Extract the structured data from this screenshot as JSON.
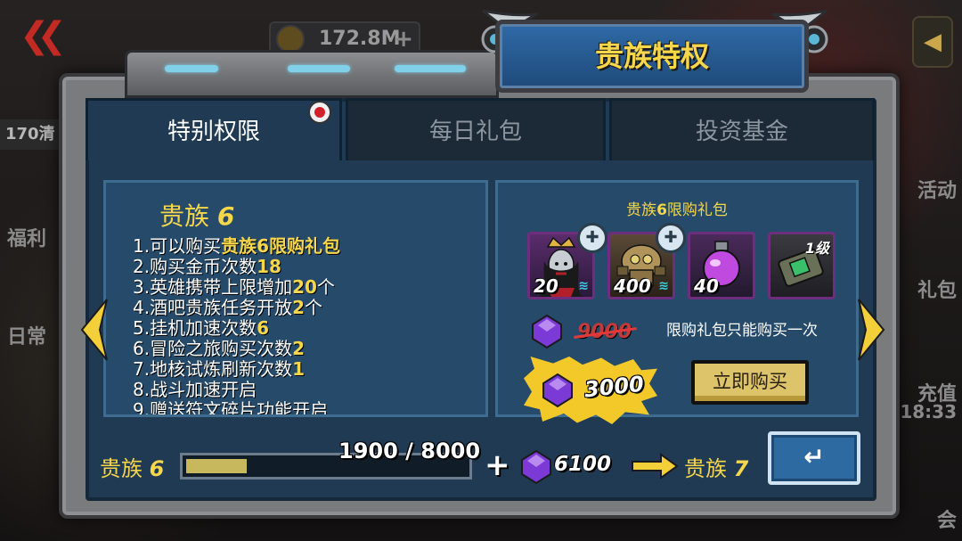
{
  "background": {
    "gold_amount": "172.8M",
    "count_badge": "170",
    "count_badge_suffix": "清",
    "left_labels": [
      "福利",
      "日常"
    ],
    "right_labels": [
      "活动",
      "礼包",
      "充值",
      "18:33",
      "会"
    ]
  },
  "title": "贵族特权",
  "tabs": [
    {
      "label": "特别权限",
      "active": true,
      "has_dot": true
    },
    {
      "label": "每日礼包",
      "active": false
    },
    {
      "label": "投资基金",
      "active": false
    }
  ],
  "privileges": {
    "heading_prefix": "贵族",
    "heading_level": "6",
    "items": [
      {
        "num": "1.",
        "text": "可以购买",
        "highlight": "贵族6限购礼包",
        "suffix": ""
      },
      {
        "num": "2.",
        "text": "购买金币次数",
        "highlight": "18",
        "suffix": ""
      },
      {
        "num": "3.",
        "text": "英雄携带上限增加",
        "highlight": "20",
        "suffix": "个"
      },
      {
        "num": "4.",
        "text": "酒吧贵族任务开放",
        "highlight": "2",
        "suffix": "个"
      },
      {
        "num": "5.",
        "text": "挂机加速次数",
        "highlight": "6",
        "suffix": ""
      },
      {
        "num": "6.",
        "text": "冒险之旅购买次数",
        "highlight": "2",
        "suffix": ""
      },
      {
        "num": "7.",
        "text": "地核试炼刷新次数",
        "highlight": "1",
        "suffix": ""
      },
      {
        "num": "8.",
        "text": "战斗加速开启",
        "highlight": "",
        "suffix": ""
      },
      {
        "num": "9.",
        "text": "赠送符文碎片功能开启",
        "highlight": "",
        "suffix": ""
      }
    ]
  },
  "gift": {
    "title_prefix": "贵族",
    "title_level": "6",
    "title_suffix": "限购礼包",
    "items": [
      {
        "icon": "queen-hero-icon",
        "qty": "20"
      },
      {
        "icon": "mech-hero-icon",
        "qty": "400"
      },
      {
        "icon": "potion-icon",
        "qty": "40"
      },
      {
        "icon": "rune-chip-icon",
        "level": "1级"
      }
    ],
    "original_price": "9000",
    "limit_note": "限购礼包只能购买一次",
    "sale_price": "3000",
    "buy_label": "立即购买"
  },
  "progress": {
    "current_rank_prefix": "贵族",
    "current_rank": "6",
    "current": 1900,
    "target": 8000,
    "text": "1900 / 8000",
    "gem_cost": "6100",
    "next_rank_prefix": "贵族",
    "next_rank": "7"
  },
  "colors": {
    "accent_yellow": "#f6d64a",
    "panel_blue": "#264a69",
    "gem_purple": "#7b3ad6",
    "buy_button": "#ddc46a"
  }
}
